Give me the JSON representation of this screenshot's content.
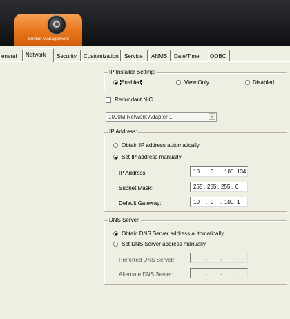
{
  "header": {
    "app_label": "Device Management",
    "icon": "globe-icon",
    "gradient_top": "#2c2e33",
    "accent": "#e8761c"
  },
  "tabs": [
    "eneral",
    "Network",
    "Security",
    "Customization",
    "Service",
    "ANMS",
    "Date/Time",
    "OOBC"
  ],
  "active_tab": "Network",
  "ip_installer": {
    "legend": "IP Installer Setting:",
    "options": [
      "Enabled",
      "View Only",
      "Disabled"
    ],
    "selected": "Enabled"
  },
  "redundant_nic": {
    "label": "Redundant NIC",
    "checked": false,
    "adapter_value": "1000M Network Adapter 1"
  },
  "ip_address": {
    "legend": "IP Address:",
    "auto_label": "Obtain IP address automatically",
    "manual_label": "Set IP address manually",
    "selected": "manual",
    "fields": [
      {
        "label": "IP Address:",
        "octets": [
          "10",
          "0",
          "100",
          "134"
        ]
      },
      {
        "label": "Subnet Mask:",
        "octets": [
          "255",
          "255",
          "255",
          "0"
        ]
      },
      {
        "label": "Default Gateway:",
        "octets": [
          "10",
          "0",
          "100",
          "1"
        ]
      }
    ]
  },
  "dns": {
    "legend": "DNS Server:",
    "auto_label": "Obtain DNS Server address automatically",
    "manual_label": "Set DNS Server address manually",
    "selected": "auto",
    "preferred_label": "Preferred DNS Server:",
    "alternate_label": "Alternate DNS Server:",
    "dots": "."
  }
}
